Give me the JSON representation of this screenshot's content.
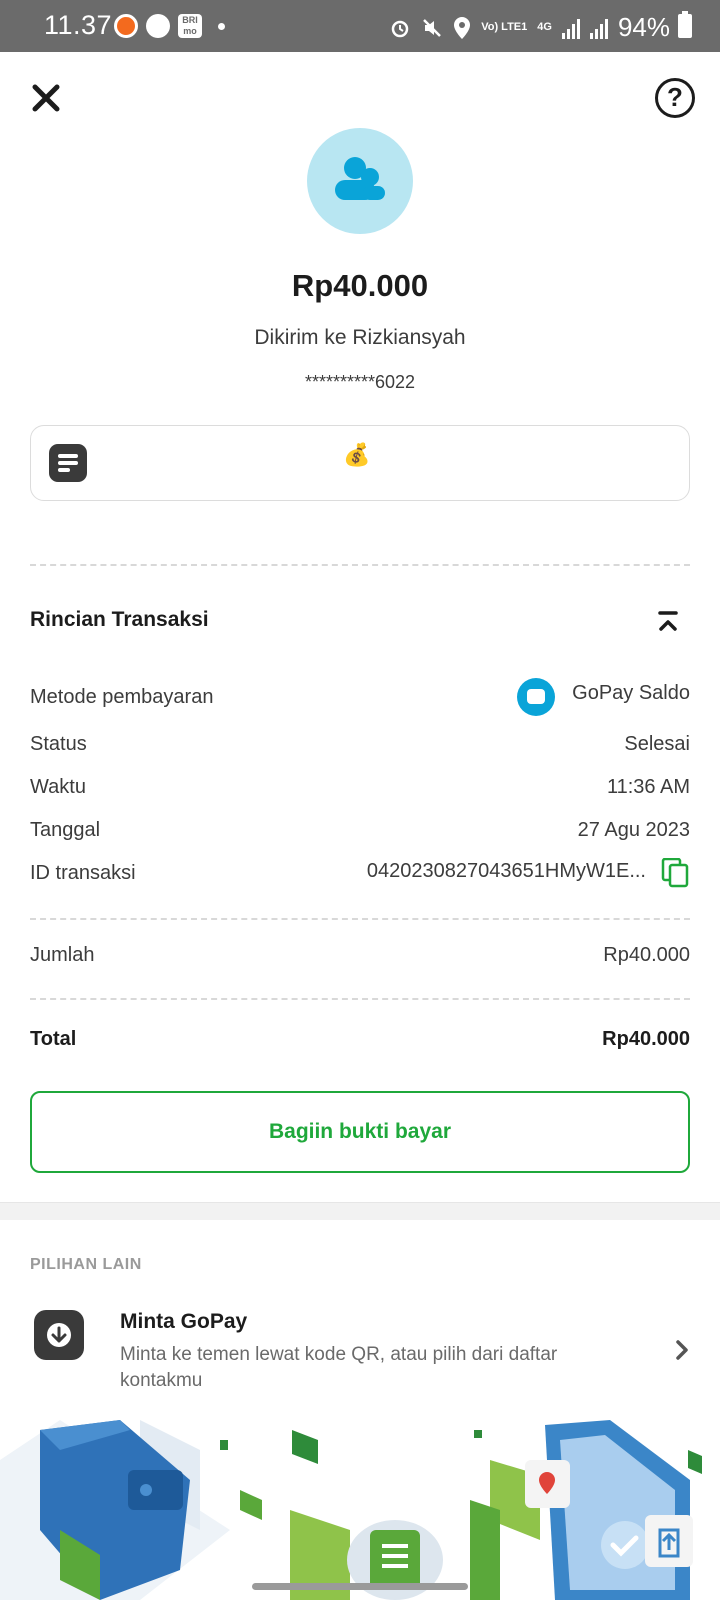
{
  "status_bar": {
    "time": "11.37",
    "bri_label": "BRI mo",
    "network_small": "Vo) LTE1",
    "network_type": "4G",
    "battery": "94%"
  },
  "header": {
    "close_icon": "close-icon",
    "help_icon": "help-icon",
    "help_glyph": "?"
  },
  "transfer": {
    "amount": "Rp40.000",
    "recipient": "Dikirim ke Rizkiansyah",
    "account_number": "**********6022",
    "note_emoji": "💰"
  },
  "details": {
    "title": "Rincian Transaksi",
    "payment_method_label": "Metode pembayaran",
    "payment_method_value": "GoPay Saldo",
    "status_label": "Status",
    "status_value": "Selesai",
    "time_label": "Waktu",
    "time_value": "11:36 AM",
    "date_label": "Tanggal",
    "date_value": "27 Agu 2023",
    "transaction_id_label": "ID transaksi",
    "transaction_id_value": "0420230827043651HMyW1E...",
    "amount_label": "Jumlah",
    "amount_value": "Rp40.000",
    "total_label": "Total",
    "total_value": "Rp40.000"
  },
  "share_button_label": "Bagiin bukti bayar",
  "other_options": {
    "title": "PILIHAN LAIN",
    "items": [
      {
        "title": "Minta GoPay",
        "description": "Minta ke temen lewat kode QR, atau pilih dari daftar kontakmu",
        "icon": "download-arrow-icon"
      }
    ]
  },
  "colors": {
    "accent_green": "#1fa83b",
    "gopay_blue": "#0aa4d8",
    "avatar_bg": "#b8e6f2"
  }
}
